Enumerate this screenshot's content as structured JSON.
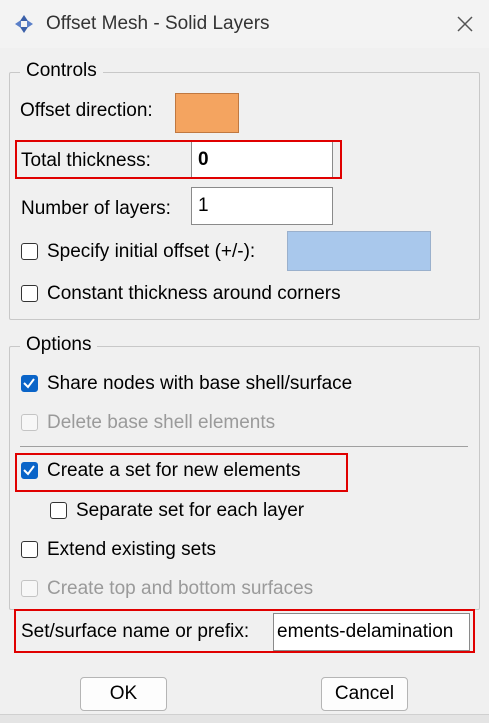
{
  "window": {
    "title": "Offset Mesh - Solid Layers",
    "icon": "abaqus-logo-icon"
  },
  "controls": {
    "legend": "Controls",
    "offset_direction_label": "Offset direction:",
    "offset_direction_color": "#f4a460",
    "total_thickness_label": "Total thickness:",
    "total_thickness_value": "0",
    "num_layers_label": "Number of layers:",
    "num_layers_value": "1",
    "specify_offset_label": "Specify initial offset (+/-):",
    "specify_offset_checked": false,
    "specify_offset_field_color": "#a9c8ec",
    "constant_thickness_label": "Constant thickness around corners",
    "constant_thickness_checked": false
  },
  "options": {
    "legend": "Options",
    "share_nodes_label": "Share nodes with base shell/surface",
    "share_nodes_checked": true,
    "delete_base_label": "Delete base shell elements",
    "delete_base_enabled": false,
    "create_set_label": "Create a set for new elements",
    "create_set_checked": true,
    "separate_set_label": "Separate set for each layer",
    "separate_set_checked": false,
    "extend_sets_label": "Extend existing sets",
    "extend_sets_checked": false,
    "create_surfaces_label": "Create top and bottom surfaces",
    "create_surfaces_enabled": false,
    "set_name_label": "Set/surface name or prefix:",
    "set_name_value": "ements-delamination"
  },
  "buttons": {
    "ok": "OK",
    "cancel": "Cancel"
  },
  "highlight_color": "#e00000",
  "accent_color": "#0a64c8"
}
